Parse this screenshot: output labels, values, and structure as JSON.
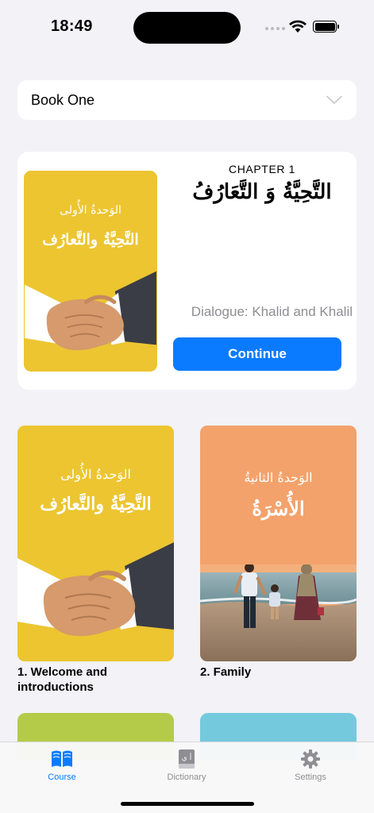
{
  "status_bar": {
    "time": "18:49"
  },
  "book_selector": {
    "label": "Book One",
    "icon": "chevron-down-icon"
  },
  "current_chapter": {
    "chapter_label": "CHAPTER 1",
    "title_arabic": "التَّحِيَّةُ وَ التَّعَارُفُ",
    "subtitle": "Dialogue: Khalid and Khalil",
    "button_label": "Continue",
    "cover": {
      "unit_label": "الوَحدةُ الأُولى",
      "title": "التَّحِيَّةُ والتَّعارُف",
      "image": "handshake",
      "color": "#ecc531"
    }
  },
  "units": [
    {
      "label": "1. Welcome and introductions",
      "cover": {
        "unit_label": "الوَحدةُ الأُولى",
        "title": "التَّحِيَّةُ والتَّعارُف",
        "image": "handshake",
        "color": "#ecc531"
      }
    },
    {
      "label": "2. Family",
      "cover": {
        "unit_label": "الوَحدةُ الثانيةُ",
        "title": "الأُسْرَةُ",
        "image": "family-on-beach",
        "color": "#f3a26b"
      }
    }
  ],
  "unit_peek_colors": [
    "#b4cb49",
    "#74c9dd"
  ],
  "tab_bar": {
    "accent": "#0a7bff",
    "inactive": "#8e8e93",
    "tabs": [
      {
        "label": "Course",
        "icon": "book-icon",
        "active": true
      },
      {
        "label": "Dictionary",
        "icon": "dictionary-icon",
        "active": false
      },
      {
        "label": "Settings",
        "icon": "gear-icon",
        "active": false
      }
    ]
  }
}
